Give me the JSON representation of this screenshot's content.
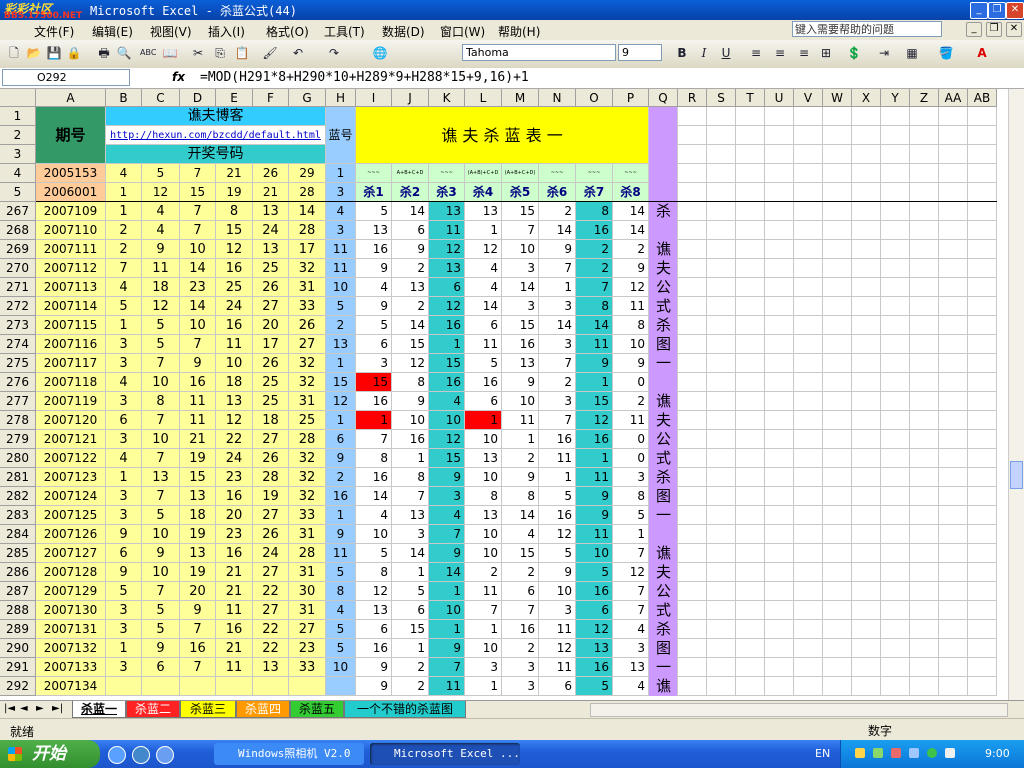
{
  "window": {
    "title": "Microsoft Excel - 杀蓝公式(44)",
    "logo_line1": "彩彩社区",
    "logo_line2": "BBS.17500.NET"
  },
  "window_buttons": {
    "minimize": "_",
    "restore": "❐",
    "close": "✕",
    "doc_minimize": "_",
    "doc_restore": "❐",
    "doc_close": "✕"
  },
  "menu": [
    {
      "id": "file",
      "label": "文件(F)"
    },
    {
      "id": "edit",
      "label": "编辑(E)"
    },
    {
      "id": "view",
      "label": "视图(V)"
    },
    {
      "id": "insert",
      "label": "插入(I)"
    },
    {
      "id": "format",
      "label": "格式(O)"
    },
    {
      "id": "tools",
      "label": "工具(T)"
    },
    {
      "id": "data",
      "label": "数据(D)"
    },
    {
      "id": "window",
      "label": "窗口(W)"
    },
    {
      "id": "help",
      "label": "帮助(H)"
    }
  ],
  "help_search": {
    "placeholder": "键入需要帮助的问题"
  },
  "toolbar": {
    "font_name": "Tahoma",
    "font_size": "9",
    "icons": [
      "new-icon",
      "open-icon",
      "save-icon",
      "permission-icon",
      "print-icon",
      "print-preview-icon",
      "spelling-icon",
      "research-icon",
      "cut-icon",
      "copy-icon",
      "paste-icon",
      "format-painter-icon",
      "undo-icon",
      "redo-icon",
      "hyperlink-icon",
      "bold-icon",
      "italic-icon",
      "underline-icon",
      "align-left-icon",
      "align-center-icon",
      "align-right-icon",
      "merge-center-icon",
      "currency-icon",
      "indent-icon",
      "borders-icon",
      "fill-color-icon",
      "font-color-icon"
    ],
    "glyphs": {
      "new": "🗋",
      "open": "📂",
      "save": "💾",
      "perm": "🔒",
      "print": "🖶",
      "preview": "🔍",
      "spell": "ABC",
      "research": "📖",
      "cut": "✂",
      "copy": "⎘",
      "paste": "📋",
      "painter": "🖌",
      "undo": "↶",
      "redo": "↷",
      "link": "🌐",
      "bold": "B",
      "italic": "I",
      "underline": "U",
      "left": "≡",
      "center": "≡",
      "right": "≡",
      "merge": "⊞",
      "currency": "💲",
      "indent": "⇥",
      "borders": "▦",
      "fill": "🪣",
      "fontcolor": "A",
      "dropdown": "▾"
    }
  },
  "formula_bar": {
    "name_box": "O292",
    "fx": "fx",
    "formula": "=MOD(H291*8+H290*10+H289*9+H288*15+9,16)+1"
  },
  "columns": [
    "A",
    "B",
    "C",
    "D",
    "E",
    "F",
    "G",
    "H",
    "I",
    "J",
    "K",
    "L",
    "M",
    "N",
    "O",
    "P",
    "Q",
    "R",
    "S",
    "T",
    "U",
    "V",
    "W",
    "X",
    "Y",
    "Z",
    "AA",
    "AB"
  ],
  "header_block": {
    "period_label": "期号",
    "blog_title": "谯夫博客",
    "blog_url": "http://hexun.com/bzcdd/default.html",
    "draw_numbers_label": "开奖号码",
    "blue_label": "蓝号",
    "kill_table_title": "谯 夫 杀 蓝 表 一",
    "kill_labels": [
      "杀1",
      "杀2",
      "杀3",
      "杀4",
      "杀5",
      "杀6",
      "杀7",
      "杀8"
    ],
    "formula_hints": [
      "~~~",
      "A+B+C+D",
      "~~~",
      "(A+B)+C+D",
      "(A+B+C+D)",
      "~~~",
      "~~~",
      "~~~"
    ]
  },
  "top_rows": [
    {
      "row": "4",
      "period": "2005153",
      "nums": [
        "4",
        "5",
        "7",
        "21",
        "26",
        "29"
      ],
      "blue": "1"
    },
    {
      "row": "5",
      "period": "2006001",
      "nums": [
        "1",
        "12",
        "15",
        "19",
        "21",
        "28"
      ],
      "blue": "3"
    }
  ],
  "data_rows": [
    {
      "row": "267",
      "period": "2007109",
      "nums": [
        "1",
        "4",
        "7",
        "8",
        "13",
        "14"
      ],
      "blue": "4",
      "kills": [
        "5",
        "14",
        "13",
        "13",
        "15",
        "2",
        "8",
        "14"
      ]
    },
    {
      "row": "268",
      "period": "2007110",
      "nums": [
        "2",
        "4",
        "7",
        "15",
        "24",
        "28"
      ],
      "blue": "3",
      "kills": [
        "13",
        "6",
        "11",
        "1",
        "7",
        "14",
        "16",
        "14"
      ]
    },
    {
      "row": "269",
      "period": "2007111",
      "nums": [
        "2",
        "9",
        "10",
        "12",
        "13",
        "17"
      ],
      "blue": "11",
      "kills": [
        "16",
        "9",
        "12",
        "12",
        "10",
        "9",
        "2",
        "2"
      ]
    },
    {
      "row": "270",
      "period": "2007112",
      "nums": [
        "7",
        "11",
        "14",
        "16",
        "25",
        "32"
      ],
      "blue": "11",
      "kills": [
        "9",
        "2",
        "13",
        "4",
        "3",
        "7",
        "2",
        "9"
      ]
    },
    {
      "row": "271",
      "period": "2007113",
      "nums": [
        "4",
        "18",
        "23",
        "25",
        "26",
        "31"
      ],
      "blue": "10",
      "kills": [
        "4",
        "13",
        "6",
        "4",
        "14",
        "1",
        "7",
        "12"
      ]
    },
    {
      "row": "272",
      "period": "2007114",
      "nums": [
        "5",
        "12",
        "14",
        "24",
        "27",
        "33"
      ],
      "blue": "5",
      "kills": [
        "9",
        "2",
        "12",
        "14",
        "3",
        "3",
        "8",
        "11"
      ]
    },
    {
      "row": "273",
      "period": "2007115",
      "nums": [
        "1",
        "5",
        "10",
        "16",
        "20",
        "26"
      ],
      "blue": "2",
      "kills": [
        "5",
        "14",
        "16",
        "6",
        "15",
        "14",
        "14",
        "8"
      ]
    },
    {
      "row": "274",
      "period": "2007116",
      "nums": [
        "3",
        "5",
        "7",
        "11",
        "17",
        "27"
      ],
      "blue": "13",
      "kills": [
        "6",
        "15",
        "1",
        "11",
        "16",
        "3",
        "11",
        "10"
      ]
    },
    {
      "row": "275",
      "period": "2007117",
      "nums": [
        "3",
        "7",
        "9",
        "10",
        "26",
        "32"
      ],
      "blue": "1",
      "kills": [
        "3",
        "12",
        "15",
        "5",
        "13",
        "7",
        "9",
        "9"
      ]
    },
    {
      "row": "276",
      "period": "2007118",
      "nums": [
        "4",
        "10",
        "16",
        "18",
        "25",
        "32"
      ],
      "blue": "15",
      "kills": [
        "15",
        "8",
        "16",
        "16",
        "9",
        "2",
        "1",
        "0"
      ],
      "hits": [
        0
      ]
    },
    {
      "row": "277",
      "period": "2007119",
      "nums": [
        "3",
        "8",
        "11",
        "13",
        "25",
        "31"
      ],
      "blue": "12",
      "kills": [
        "16",
        "9",
        "4",
        "6",
        "10",
        "3",
        "15",
        "2"
      ]
    },
    {
      "row": "278",
      "period": "2007120",
      "nums": [
        "6",
        "7",
        "11",
        "12",
        "18",
        "25"
      ],
      "blue": "1",
      "kills": [
        "1",
        "10",
        "10",
        "1",
        "11",
        "7",
        "12",
        "11"
      ],
      "hits": [
        0,
        3
      ]
    },
    {
      "row": "279",
      "period": "2007121",
      "nums": [
        "3",
        "10",
        "21",
        "22",
        "27",
        "28"
      ],
      "blue": "6",
      "kills": [
        "7",
        "16",
        "12",
        "10",
        "1",
        "16",
        "16",
        "0"
      ]
    },
    {
      "row": "280",
      "period": "2007122",
      "nums": [
        "4",
        "7",
        "19",
        "24",
        "26",
        "32"
      ],
      "blue": "9",
      "kills": [
        "8",
        "1",
        "15",
        "13",
        "2",
        "11",
        "1",
        "0"
      ]
    },
    {
      "row": "281",
      "period": "2007123",
      "nums": [
        "1",
        "13",
        "15",
        "23",
        "28",
        "32"
      ],
      "blue": "2",
      "kills": [
        "16",
        "8",
        "9",
        "10",
        "9",
        "1",
        "11",
        "3"
      ]
    },
    {
      "row": "282",
      "period": "2007124",
      "nums": [
        "3",
        "7",
        "13",
        "16",
        "19",
        "32"
      ],
      "blue": "16",
      "kills": [
        "14",
        "7",
        "3",
        "8",
        "8",
        "5",
        "9",
        "8"
      ]
    },
    {
      "row": "283",
      "period": "2007125",
      "nums": [
        "3",
        "5",
        "18",
        "20",
        "27",
        "33"
      ],
      "blue": "1",
      "kills": [
        "4",
        "13",
        "4",
        "13",
        "14",
        "16",
        "9",
        "5"
      ]
    },
    {
      "row": "284",
      "period": "2007126",
      "nums": [
        "9",
        "10",
        "19",
        "23",
        "26",
        "31"
      ],
      "blue": "9",
      "kills": [
        "10",
        "3",
        "7",
        "10",
        "4",
        "12",
        "11",
        "1"
      ]
    },
    {
      "row": "285",
      "period": "2007127",
      "nums": [
        "6",
        "9",
        "13",
        "16",
        "24",
        "28"
      ],
      "blue": "11",
      "kills": [
        "5",
        "14",
        "9",
        "10",
        "15",
        "5",
        "10",
        "7"
      ]
    },
    {
      "row": "286",
      "period": "2007128",
      "nums": [
        "9",
        "10",
        "19",
        "21",
        "27",
        "31"
      ],
      "blue": "5",
      "kills": [
        "8",
        "1",
        "14",
        "2",
        "2",
        "9",
        "5",
        "12"
      ]
    },
    {
      "row": "287",
      "period": "2007129",
      "nums": [
        "5",
        "7",
        "20",
        "21",
        "22",
        "30"
      ],
      "blue": "8",
      "kills": [
        "12",
        "5",
        "1",
        "11",
        "6",
        "10",
        "16",
        "7"
      ]
    },
    {
      "row": "288",
      "period": "2007130",
      "nums": [
        "3",
        "5",
        "9",
        "11",
        "27",
        "31"
      ],
      "blue": "4",
      "kills": [
        "13",
        "6",
        "10",
        "7",
        "7",
        "3",
        "6",
        "7"
      ]
    },
    {
      "row": "289",
      "period": "2007131",
      "nums": [
        "3",
        "5",
        "7",
        "16",
        "22",
        "27"
      ],
      "blue": "5",
      "kills": [
        "6",
        "15",
        "1",
        "1",
        "16",
        "11",
        "12",
        "4"
      ]
    },
    {
      "row": "290",
      "period": "2007132",
      "nums": [
        "1",
        "9",
        "16",
        "21",
        "22",
        "23"
      ],
      "blue": "5",
      "kills": [
        "16",
        "1",
        "9",
        "10",
        "2",
        "12",
        "13",
        "3"
      ]
    },
    {
      "row": "291",
      "period": "2007133",
      "nums": [
        "3",
        "6",
        "7",
        "11",
        "13",
        "33"
      ],
      "blue": "10",
      "kills": [
        "9",
        "2",
        "7",
        "3",
        "3",
        "11",
        "16",
        "13"
      ]
    },
    {
      "row": "292",
      "period": "2007134",
      "nums": [
        "",
        "",
        "",
        "",
        "",
        ""
      ],
      "blue": "",
      "kills": [
        "9",
        "2",
        "11",
        "1",
        "3",
        "6",
        "5",
        "4"
      ]
    }
  ],
  "side_column_text": [
    "杀",
    "",
    "谯",
    "夫",
    "公",
    "式",
    "杀",
    "图",
    "一",
    "",
    "谯",
    "夫",
    "公",
    "式",
    "杀",
    "图",
    "一",
    "",
    "谯",
    "夫",
    "公",
    "式",
    "杀",
    "图",
    "一",
    "谯"
  ],
  "sheet_nav": [
    "|◄",
    "◄",
    "►",
    "►|"
  ],
  "sheets": [
    {
      "id": "s1",
      "label": "杀蓝一",
      "bg": "#ffffff",
      "fg": "#000000"
    },
    {
      "id": "s2",
      "label": "杀蓝二",
      "bg": "#ff2222",
      "fg": "#ffffff"
    },
    {
      "id": "s3",
      "label": "杀蓝三",
      "bg": "#ffff00",
      "fg": "#000000"
    },
    {
      "id": "s4",
      "label": "杀蓝四",
      "bg": "#ff9900",
      "fg": "#ffffff"
    },
    {
      "id": "s5",
      "label": "杀蓝五",
      "bg": "#33cc33",
      "fg": "#000000"
    },
    {
      "id": "s6",
      "label": "一个不错的杀蓝图",
      "bg": "#22cccc",
      "fg": "#000000"
    }
  ],
  "status": {
    "ready": "就绪",
    "mode": "数字"
  },
  "taskbar": {
    "start": "开始",
    "tasks": [
      {
        "id": "photo",
        "label": "Windows照相机 V2.0"
      },
      {
        "id": "excel",
        "label": "Microsoft Excel ..."
      }
    ],
    "lang": "EN",
    "clock": "9:00"
  },
  "colors": {
    "header_green": "#339966",
    "cyan": "#33ccff",
    "blue_cell": "#99ccff",
    "yellow": "#ffff00",
    "light_yellow": "#ffff99",
    "peach": "#ffcc99",
    "teal": "#33cccc",
    "light_green": "#ccffcc",
    "purple": "#cc99ff",
    "hit_red": "#ff0000"
  }
}
